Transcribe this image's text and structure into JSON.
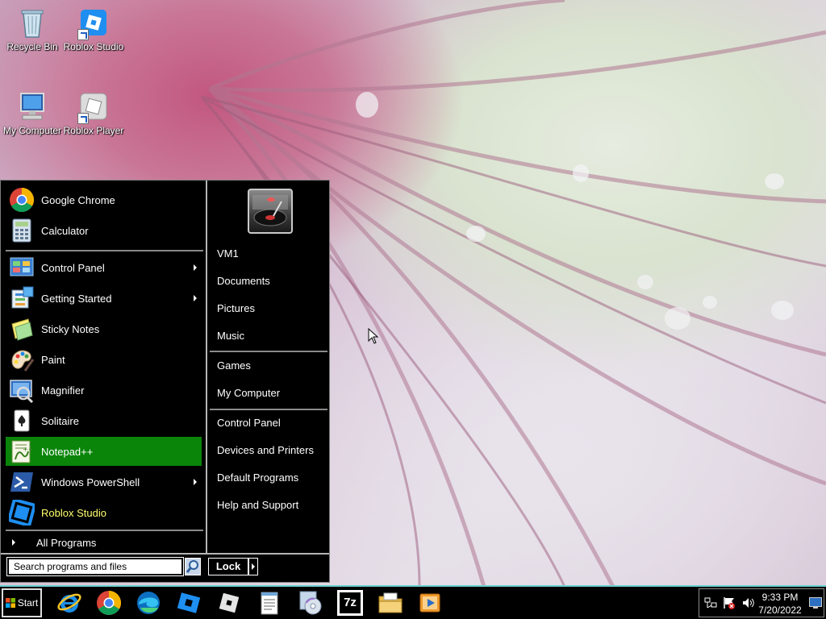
{
  "desktop": {
    "icons": [
      {
        "label": "Recycle Bin"
      },
      {
        "label": "Roblox Studio"
      },
      {
        "label": "My Computer"
      },
      {
        "label": "Roblox Player"
      }
    ]
  },
  "start_menu": {
    "pinned": [
      {
        "label": "Google Chrome",
        "icon": "chrome-icon"
      },
      {
        "label": "Calculator",
        "icon": "calculator-icon"
      }
    ],
    "programs": [
      {
        "label": "Control Panel",
        "icon": "control-panel-icon",
        "submenu": true
      },
      {
        "label": "Getting Started",
        "icon": "getting-started-icon",
        "submenu": true
      },
      {
        "label": "Sticky Notes",
        "icon": "sticky-notes-icon"
      },
      {
        "label": "Paint",
        "icon": "paint-icon"
      },
      {
        "label": "Magnifier",
        "icon": "magnifier-icon"
      },
      {
        "label": "Solitaire",
        "icon": "solitaire-icon"
      },
      {
        "label": "Notepad++",
        "icon": "notepadpp-icon",
        "selected": true
      },
      {
        "label": "Windows PowerShell",
        "icon": "powershell-icon",
        "submenu": true
      },
      {
        "label": "Roblox Studio",
        "icon": "roblox-studio-icon",
        "recent": true
      }
    ],
    "all_programs_label": "All Programs",
    "search_placeholder": "Search programs and files",
    "places": {
      "user": "VM1",
      "documents": "Documents",
      "pictures": "Pictures",
      "music": "Music",
      "games": "Games",
      "my_computer": "My Computer",
      "control_panel": "Control Panel",
      "devices_printers": "Devices and Printers",
      "default_programs": "Default Programs",
      "help_support": "Help and Support"
    },
    "lock_label": "Lock"
  },
  "taskbar": {
    "start_label": "Start",
    "pinned_apps": [
      "internet-explorer-icon",
      "chrome-icon",
      "edge-icon",
      "roblox-studio-icon",
      "roblox-player-icon",
      "notepad-icon",
      "media-disc-icon",
      "7zip-icon",
      "file-explorer-icon",
      "media-player-icon"
    ],
    "seven_zip_label": "7z",
    "clock": {
      "time": "9:33 PM",
      "date": "7/20/2022"
    }
  },
  "colors": {
    "menu_bg": "#000000",
    "selected_item": "#0a850a",
    "recent_item_text": "#ffff70",
    "taskbar_border": "#6fd0d0"
  }
}
